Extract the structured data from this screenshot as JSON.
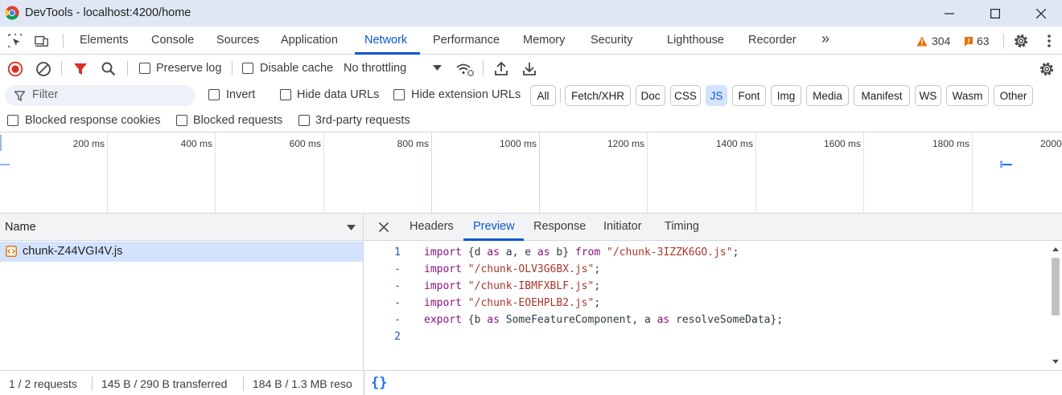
{
  "window": {
    "title": "DevTools - localhost:4200/home"
  },
  "tabs": {
    "items": [
      "Elements",
      "Console",
      "Sources",
      "Application",
      "Network",
      "Performance",
      "Memory",
      "Security",
      "Lighthouse",
      "Recorder"
    ],
    "active": "Network",
    "more": "»",
    "warnings_count": "304",
    "issues_count": "63"
  },
  "network_toolbar": {
    "preserve_log": "Preserve log",
    "disable_cache": "Disable cache",
    "throttling": "No throttling"
  },
  "filter": {
    "placeholder": "Filter",
    "invert": "Invert",
    "hide_data_urls": "Hide data URLs",
    "hide_extension_urls": "Hide extension URLs",
    "types": [
      "All",
      "Fetch/XHR",
      "Doc",
      "CSS",
      "JS",
      "Font",
      "Img",
      "Media",
      "Manifest",
      "WS",
      "Wasm",
      "Other"
    ],
    "active_type": "JS",
    "blocked_response_cookies": "Blocked response cookies",
    "blocked_requests": "Blocked requests",
    "third_party_requests": "3rd-party requests"
  },
  "overview": {
    "tick_labels": [
      "200 ms",
      "400 ms",
      "600 ms",
      "800 ms",
      "1000 ms",
      "1200 ms",
      "1400 ms",
      "1600 ms",
      "1800 ms",
      "2000"
    ]
  },
  "requests": {
    "column_name": "Name",
    "rows": [
      {
        "name": "chunk-Z44VGI4V.js"
      }
    ]
  },
  "details": {
    "tabs": [
      "Headers",
      "Preview",
      "Response",
      "Initiator",
      "Timing"
    ],
    "active": "Preview",
    "code": [
      {
        "ln": "1",
        "tokens": [
          [
            "kw",
            "import"
          ],
          [
            "p",
            " {d "
          ],
          [
            "kw",
            "as"
          ],
          [
            "p",
            " a, e "
          ],
          [
            "kw",
            "as"
          ],
          [
            "p",
            " b} "
          ],
          [
            "kw",
            "from"
          ],
          [
            "p",
            " "
          ],
          [
            "str",
            "\"/chunk-3IZZK6GO.js\""
          ],
          [
            "p",
            ";"
          ]
        ]
      },
      {
        "ln": "-",
        "tokens": [
          [
            "kw",
            "import"
          ],
          [
            "p",
            " "
          ],
          [
            "str",
            "\"/chunk-OLV3G6BX.js\""
          ],
          [
            "p",
            ";"
          ]
        ]
      },
      {
        "ln": "-",
        "tokens": [
          [
            "kw",
            "import"
          ],
          [
            "p",
            " "
          ],
          [
            "str",
            "\"/chunk-IBMFXBLF.js\""
          ],
          [
            "p",
            ";"
          ]
        ]
      },
      {
        "ln": "-",
        "tokens": [
          [
            "kw",
            "import"
          ],
          [
            "p",
            " "
          ],
          [
            "str",
            "\"/chunk-EOEHPLB2.js\""
          ],
          [
            "p",
            ";"
          ]
        ]
      },
      {
        "ln": "-",
        "tokens": [
          [
            "kw",
            "export"
          ],
          [
            "p",
            " {b "
          ],
          [
            "kw",
            "as"
          ],
          [
            "p",
            " SomeFeatureComponent, a "
          ],
          [
            "kw",
            "as"
          ],
          [
            "p",
            " resolveSomeData};"
          ]
        ]
      },
      {
        "ln": "2",
        "tokens": []
      }
    ]
  },
  "status": {
    "requests": "1 / 2 requests",
    "transferred": "145 B / 290 B transferred",
    "resources": "184 B / 1.3 MB reso",
    "pretty_print": "{}"
  },
  "colors": {
    "accent": "#0b57d0",
    "record_red": "#d93025",
    "warning_orange": "#e8710a"
  }
}
